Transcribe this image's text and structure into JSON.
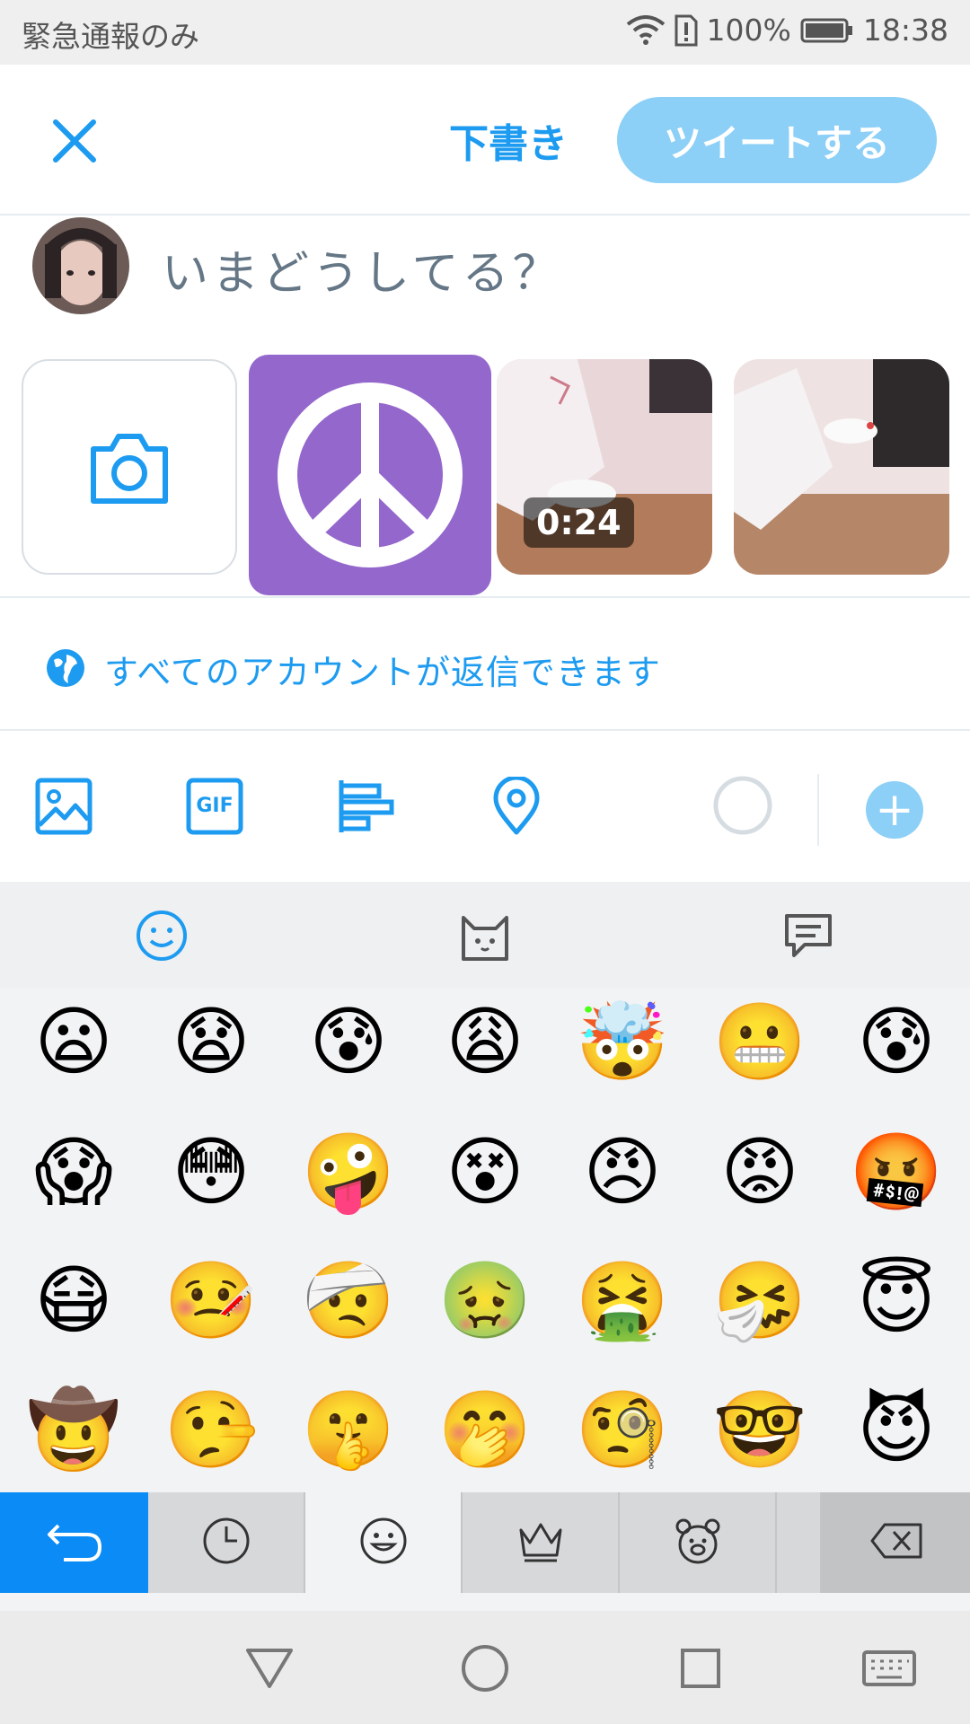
{
  "status_bar": {
    "carrier_text": "緊急通報のみ",
    "battery": "100%",
    "time": "18:38",
    "icons": [
      "wifi-icon",
      "sim-alert-icon",
      "battery-icon"
    ]
  },
  "header": {
    "close_icon": "close-icon",
    "draft_label": "下書き",
    "tweet_label": "ツイートする",
    "accent_color": "#1d9bf0",
    "tweet_button_color": "#8ccff7"
  },
  "composer": {
    "placeholder": "いまどうしてる？"
  },
  "media": {
    "tiles": [
      {
        "kind": "camera",
        "icon": "camera-icon"
      },
      {
        "kind": "image",
        "icon": "peace-icon",
        "color": "#9467cc"
      },
      {
        "kind": "video",
        "duration": "0:24"
      },
      {
        "kind": "photo"
      }
    ]
  },
  "reply": {
    "icon": "globe-icon",
    "label": "すべてのアカウントが返信できます"
  },
  "toolbar": {
    "icons": [
      "image-icon",
      "gif-icon",
      "poll-icon",
      "location-icon"
    ],
    "gif_text": "GIF",
    "add_label": "+"
  },
  "keyboard": {
    "tabs": [
      "smiley-icon",
      "cat-face-icon",
      "chat-bubble-icon"
    ],
    "emoji_rows": [
      [
        "😦",
        "😧",
        "😰",
        "😩",
        "🤯",
        "😬",
        "😰"
      ],
      [
        "😱",
        "😳",
        "🤪",
        "😵",
        "😠",
        "😡",
        "🤬"
      ],
      [
        "😷",
        "🤒",
        "🤕",
        "🤢",
        "🤮",
        "🤧",
        "😇"
      ],
      [
        "🤠",
        "🤥",
        "🤫",
        "🤭",
        "🧐",
        "🤓",
        "😈"
      ]
    ],
    "bottom_keys": [
      "back-icon",
      "recent-icon",
      "emoji-icon",
      "crown-icon",
      "bear-icon",
      "delete-icon"
    ]
  },
  "nav": {
    "icons": [
      "back-triangle-icon",
      "home-circle-icon",
      "recents-square-icon",
      "keyboard-icon"
    ]
  }
}
